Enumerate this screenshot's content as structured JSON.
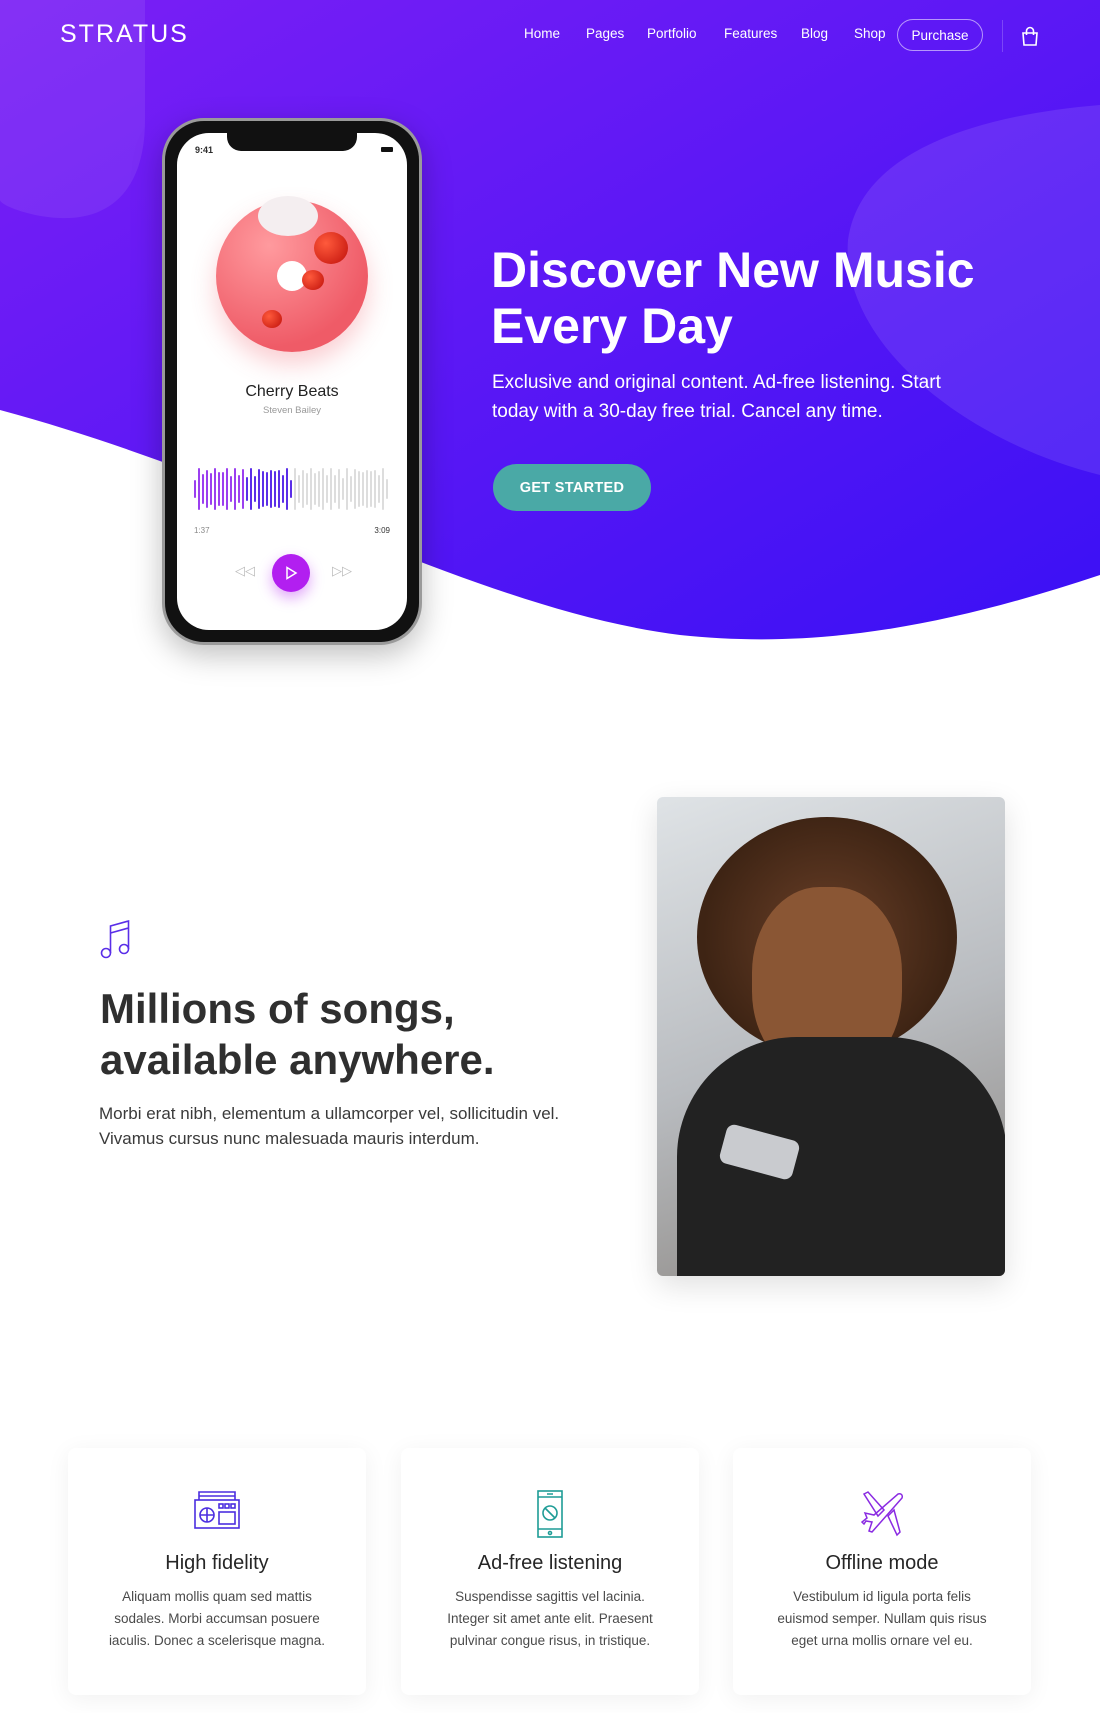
{
  "brand": "STRATUS",
  "nav": {
    "items": [
      "Home",
      "Pages",
      "Portfolio",
      "Features",
      "Blog",
      "Shop"
    ],
    "purchase": "Purchase",
    "cart_icon": "shopping-bag-icon"
  },
  "colors": {
    "hero_start": "#7b1ff5",
    "hero_end": "#3a10f5",
    "accent": "#4aa9a6",
    "play": "#b21ff0"
  },
  "hero": {
    "title": "Discover New Music Every Day",
    "subtitle": "Exclusive and original content. Ad-free listening. Start today with a 30-day free trial. Cancel any time.",
    "cta": "GET STARTED"
  },
  "phone": {
    "time": "9:41",
    "track": "Cherry Beats",
    "artist": "Steven Bailey",
    "elapsed": "1:37",
    "duration": "3:09",
    "progress": 0.5
  },
  "section2": {
    "icon": "music-note-icon",
    "title": "Millions of songs, available anywhere.",
    "text": "Morbi erat nibh, elementum a ullamcorper vel, sollicitudin vel. Vivamus cursus nunc malesuada mauris interdum."
  },
  "features": [
    {
      "icon": "radio-icon",
      "title": "High fidelity",
      "text": "Aliquam mollis quam sed mattis sodales. Morbi accumsan posuere iaculis. Donec a scelerisque magna."
    },
    {
      "icon": "no-ads-phone-icon",
      "title": "Ad-free listening",
      "text": "Suspendisse sagittis vel lacinia. Integer sit amet ante elit. Praesent pulvinar congue risus, in tristique."
    },
    {
      "icon": "airplane-icon",
      "title": "Offline mode",
      "text": "Vestibulum id ligula porta felis euismod semper. Nullam quis risus eget urna mollis ornare vel eu."
    }
  ]
}
